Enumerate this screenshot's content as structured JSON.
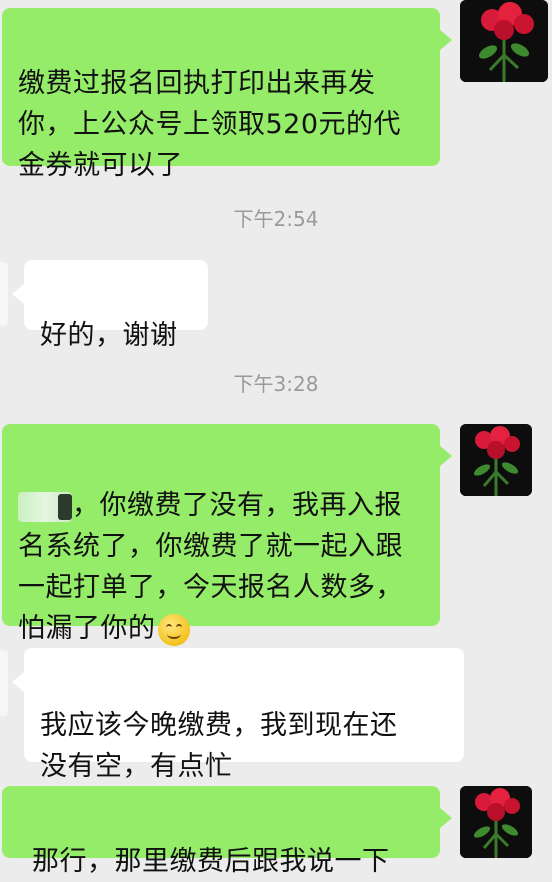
{
  "messages": [
    {
      "text": "缴费过报名回执打印出来再发\n你，上公众号上领取520元的代\n金券就可以了"
    },
    {
      "text": "好的，谢谢"
    },
    {
      "text_after_redaction": "，你缴费了没有，我再入报\n名系统了，你缴费了就一起入跟\n一起打单了，今天报名人数多，\n怕漏了你的"
    },
    {
      "text": "我应该今晚缴费，我到现在还\n没有空，有点忙"
    },
    {
      "text": "那行，那里缴费后跟我说一下"
    }
  ],
  "timestamps": [
    "下午2:54",
    "下午3:28"
  ],
  "icons": {
    "contact_avatar": "rose-bouquet-avatar",
    "emoji": "smiling-face-emoji"
  },
  "colors": {
    "sent_bubble": "#95ec69",
    "received_bubble": "#ffffff",
    "background": "#ececec",
    "timestamp": "#9a9a9a"
  }
}
